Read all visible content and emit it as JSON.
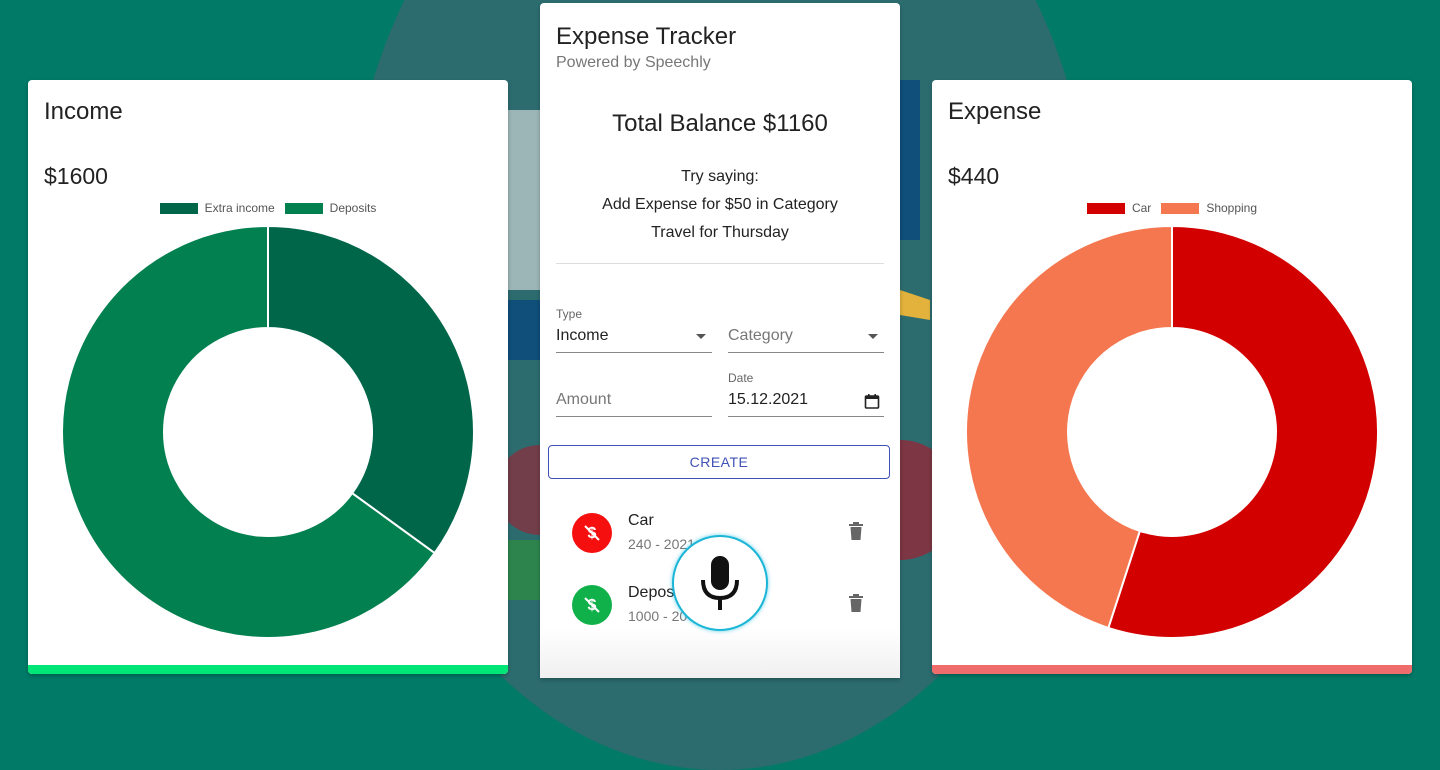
{
  "income": {
    "title": "Income",
    "amount": "$1600",
    "accent": "#00e676",
    "legend": [
      {
        "label": "Extra income",
        "color": "#00664a"
      },
      {
        "label": "Deposits",
        "color": "#02804f"
      }
    ]
  },
  "expense": {
    "title": "Expense",
    "amount": "$440",
    "accent": "#ef6c6c",
    "legend": [
      {
        "label": "Car",
        "color": "#d30000"
      },
      {
        "label": "Shopping",
        "color": "#f5774f"
      }
    ]
  },
  "main": {
    "title": "Expense Tracker",
    "subtitle": "Powered by Speechly",
    "balance": "Total Balance $1160",
    "hint_line1": "Try saying:",
    "hint_line2": "Add Expense for $50 in Category",
    "hint_line3": "Travel for Thursday",
    "form": {
      "type_label": "Type",
      "type_value": "Income",
      "category_placeholder": "Category",
      "amount_placeholder": "Amount",
      "date_label": "Date",
      "date_value": "15.12.2021",
      "create_label": "CREATE"
    },
    "transactions": [
      {
        "title": "Car",
        "subtitle": "240 - 2021",
        "kind": "expense",
        "color": "#f50f0f"
      },
      {
        "title": "Depos",
        "subtitle": "1000 - 20",
        "kind": "income",
        "color": "#10b04a"
      }
    ]
  },
  "chart_data": [
    {
      "type": "pie",
      "title": "Income",
      "categories": [
        "Extra income",
        "Deposits"
      ],
      "values": [
        35,
        65
      ],
      "colors": [
        "#00664a",
        "#02804f"
      ]
    },
    {
      "type": "pie",
      "title": "Expense",
      "categories": [
        "Car",
        "Shopping"
      ],
      "values": [
        55,
        45
      ],
      "colors": [
        "#d30000",
        "#f5774f"
      ]
    }
  ]
}
